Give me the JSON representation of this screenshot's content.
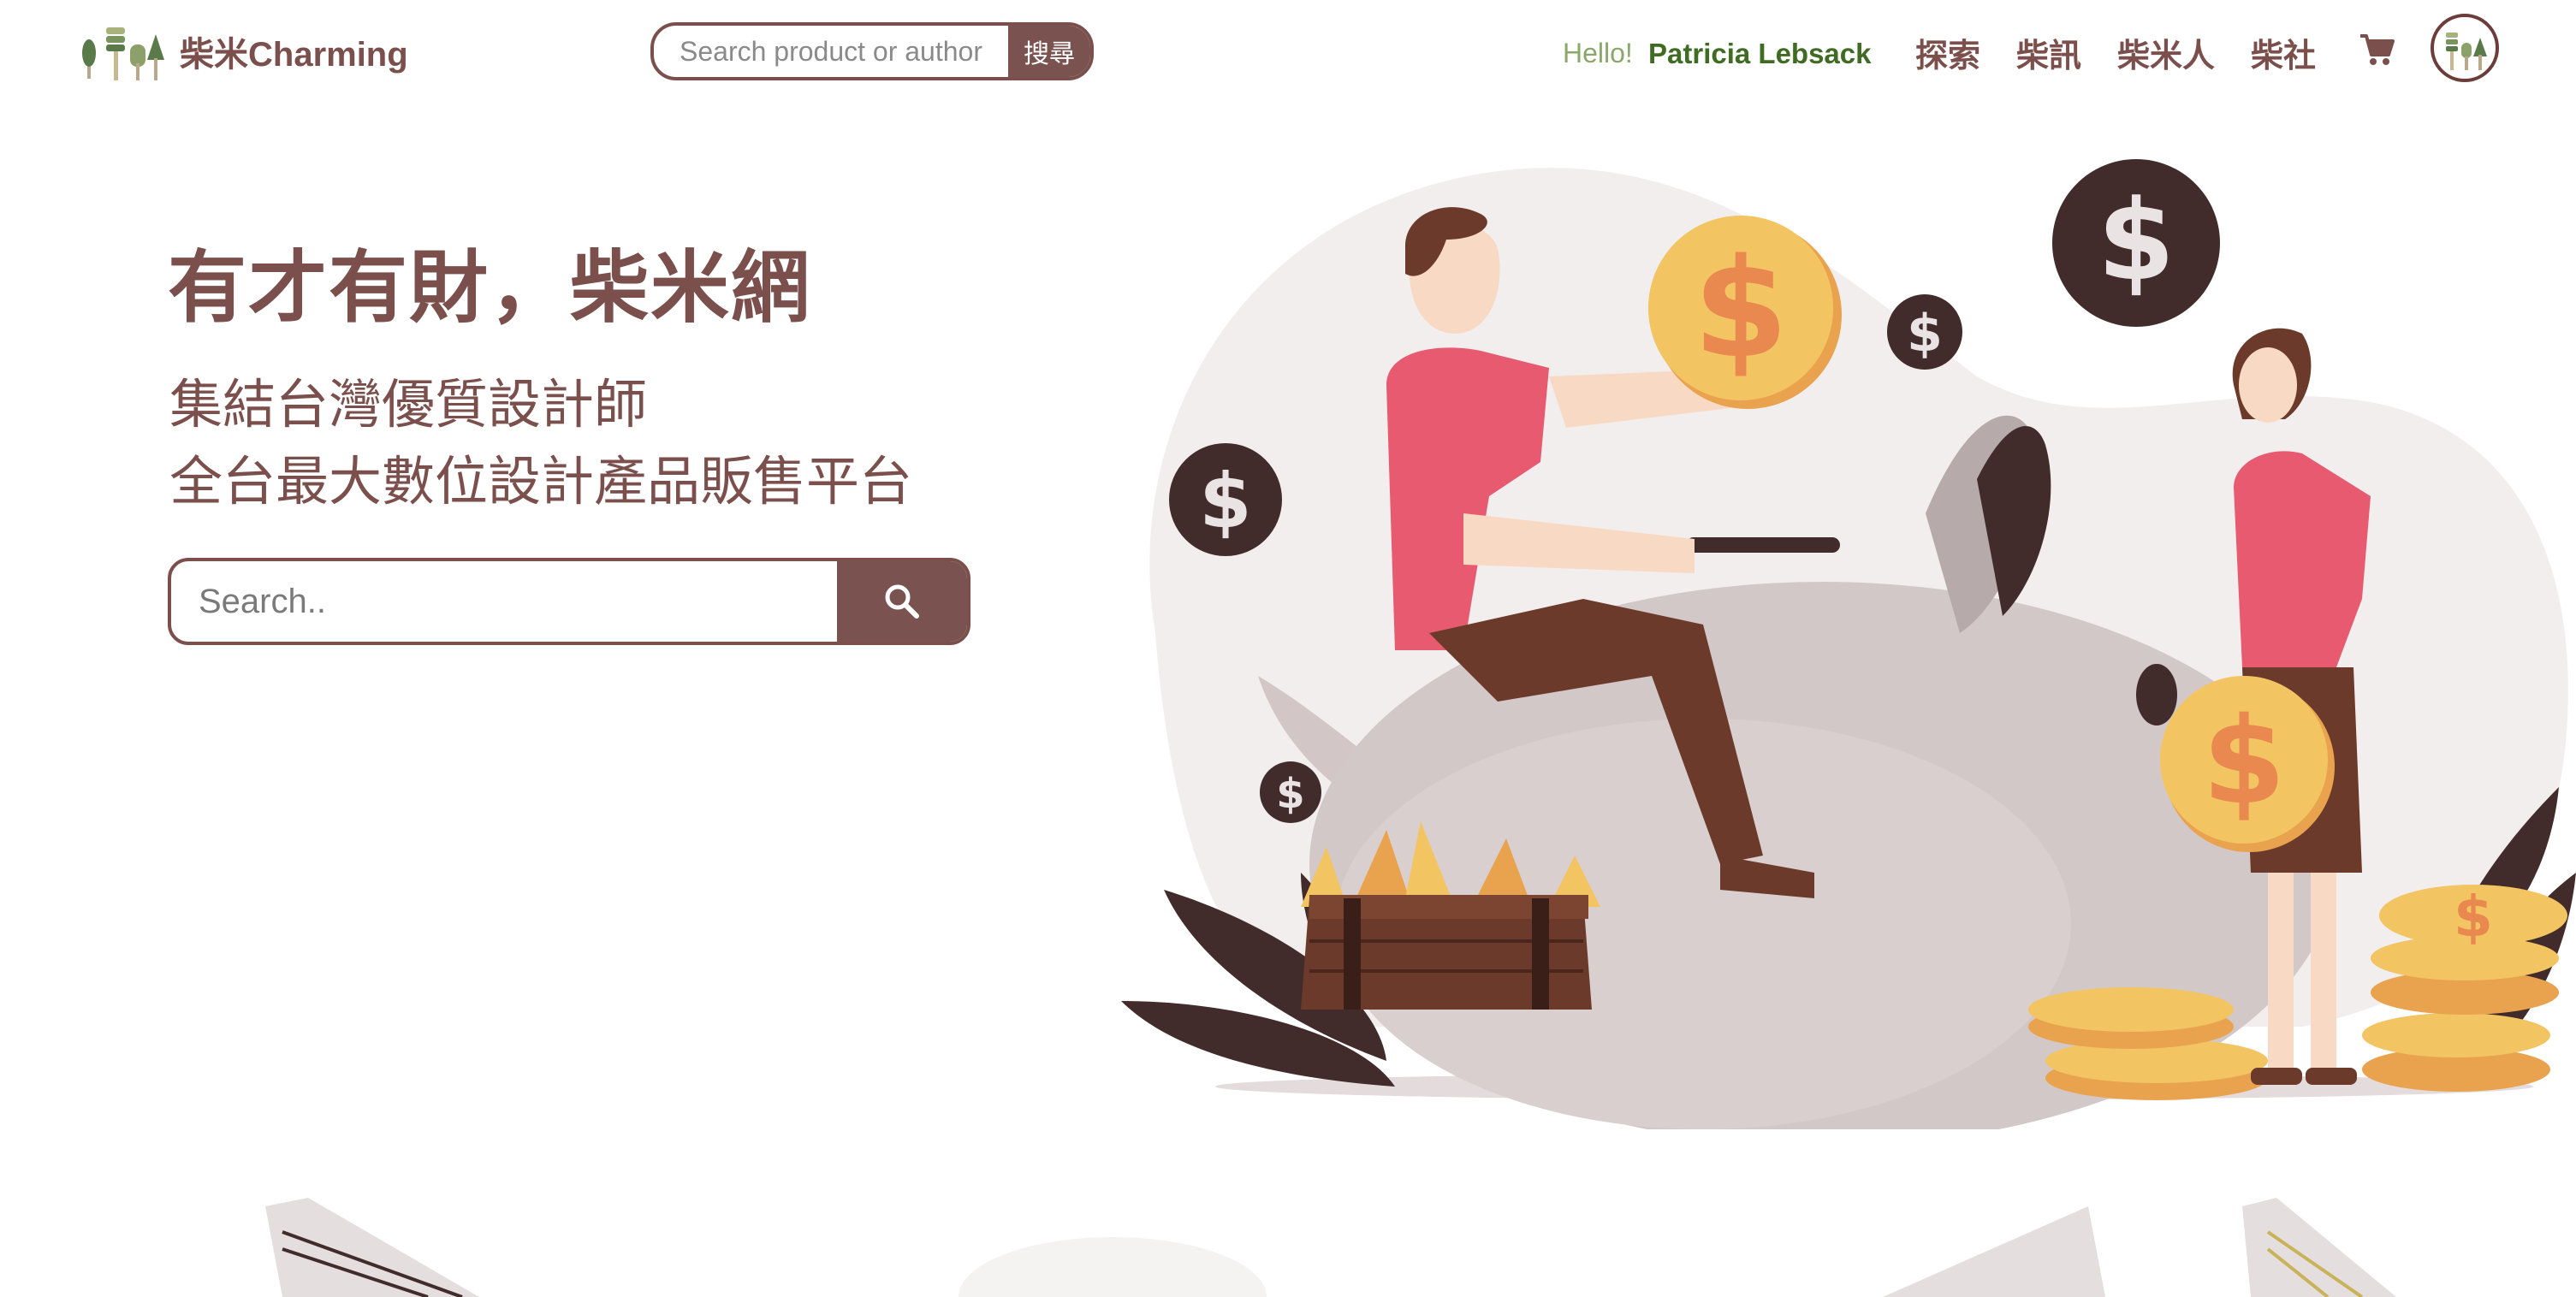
{
  "navbar": {
    "logo_text": "柴米Charming",
    "search_placeholder": "Search product or author",
    "search_button": "搜尋",
    "hello": "Hello!",
    "username": "Patricia Lebsack",
    "links": [
      "探索",
      "柴訊",
      "柴米人",
      "柴社"
    ]
  },
  "hero": {
    "title": "有才有財，柴米網",
    "subtitle_line1": "集結台灣優質設計師",
    "subtitle_line2": "全台最大數位設計產品販售平台",
    "search_placeholder": "Search.."
  },
  "icons": {
    "logo": "trees-logo-icon",
    "cart": "cart-icon",
    "search": "search-icon",
    "avatar": "avatar"
  },
  "colors": {
    "brand": "#7a4f4c",
    "button": "#7a5350",
    "hello": "#8aa86a",
    "username": "#3f6b22",
    "coin": "#f2c462",
    "shirt": "#e85a70"
  }
}
